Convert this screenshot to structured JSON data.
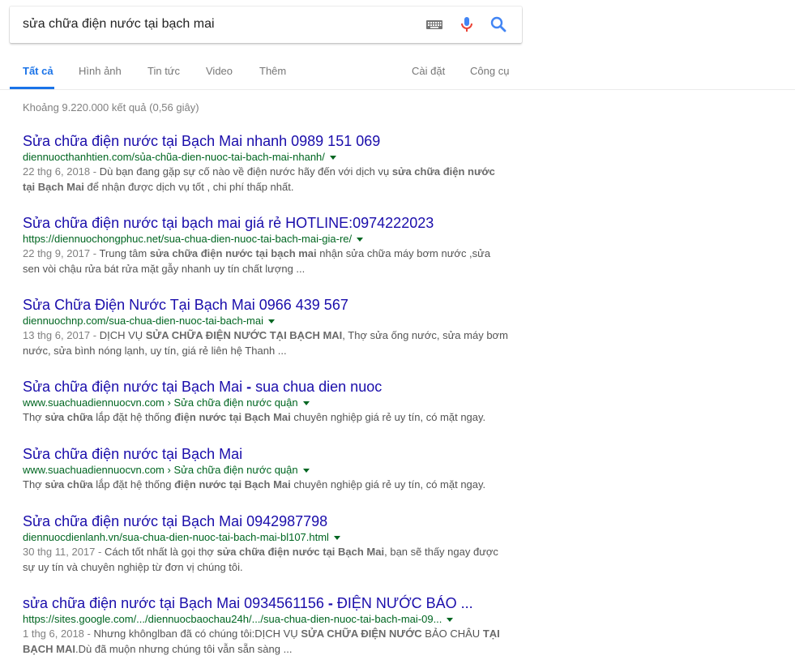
{
  "search": {
    "query": "sửa chữa điện nước tại bạch mai",
    "keyboard_icon": "keyboard-icon",
    "mic_icon": "microphone-icon",
    "search_icon": "search-icon",
    "colors": {
      "mic_blue": "#4285f4",
      "mic_red": "#ea4335",
      "search_blue": "#4285f4"
    }
  },
  "tabs": {
    "all": "Tất cả",
    "images": "Hình ảnh",
    "news": "Tin tức",
    "video": "Video",
    "more": "Thêm",
    "settings": "Cài đặt",
    "tools": "Công cụ",
    "active_color": "#1a73e8"
  },
  "stats": "Khoảng 9.220.000 kết quả (0,56 giây)",
  "results": [
    {
      "title": "Sửa chữa điện nước tại Bạch Mai nhanh 0989 151 069",
      "url": "diennuocthanhtien.com/sủa-chũa-dien-nuoc-tai-bach-mai-nhanh/",
      "date": "22 thg 6, 2018 - ",
      "snippet_parts": [
        {
          "t": "Dù bạn đang gặp sự cố nào về điện nước hãy đến với dịch vụ ",
          "b": false
        },
        {
          "t": "sửa chữa điện nước tại Bạch Mai",
          "b": true
        },
        {
          "t": " để nhận được dịch vụ tốt , chi phí thấp nhất.",
          "b": false
        }
      ]
    },
    {
      "title": "Sửa chữa điện nước tại bạch mai giá rẻ HOTLINE:0974222023",
      "url": "https://diennuochongphuc.net/sua-chua-dien-nuoc-tai-bach-mai-gia-re/",
      "date": "22 thg 9, 2017 - ",
      "snippet_parts": [
        {
          "t": "Trung tâm ",
          "b": false
        },
        {
          "t": "sửa chữa điện nước tại bạch mai",
          "b": true
        },
        {
          "t": " nhận sửa chữa máy bơm nước ,sửa sen vòi chậu rửa bát rửa mặt gẫy nhanh uy tín chất lượng ...",
          "b": false
        }
      ]
    },
    {
      "title": "Sửa Chữa Điện Nước Tại Bạch Mai 0966 439 567",
      "url": "diennuochnp.com/sua-chua-dien-nuoc-tai-bach-mai",
      "date": "13 thg 6, 2017 - ",
      "snippet_parts": [
        {
          "t": "DỊCH VỤ ",
          "b": false
        },
        {
          "t": "SỬA CHỮA ĐIỆN NƯỚC TẠI BẠCH MAI",
          "b": true
        },
        {
          "t": ", Thợ sửa ống nước, sửa máy bơm nước, sửa bình nóng lạnh, uy tín, giá rẻ liên hệ Thanh ...",
          "b": false
        }
      ]
    },
    {
      "title_parts": [
        {
          "t": "Sửa chữa điện nước tại Bạch Mai",
          "b": false
        },
        {
          "t": " - ",
          "b": true
        },
        {
          "t": "sua chua dien nuoc",
          "b": false
        }
      ],
      "url": "www.suachuadiennuocvn.com",
      "crumb": " › Sửa chữa điện nước quận",
      "date": "",
      "snippet_parts": [
        {
          "t": "Thợ ",
          "b": false
        },
        {
          "t": "sửa chữa",
          "b": true
        },
        {
          "t": " lắp đặt hệ thống ",
          "b": false
        },
        {
          "t": "điện nước tại Bạch Mai",
          "b": true
        },
        {
          "t": " chuyên nghiệp giá rẻ uy tín, có mặt ngay.",
          "b": false
        }
      ]
    },
    {
      "title": "Sửa chữa điện nước tại Bạch Mai",
      "url": "www.suachuadiennuocvn.com",
      "crumb": " › Sửa chữa điện nước quận",
      "date": "",
      "snippet_parts": [
        {
          "t": "Thợ ",
          "b": false
        },
        {
          "t": "sửa chữa",
          "b": true
        },
        {
          "t": " lắp đặt hệ thống ",
          "b": false
        },
        {
          "t": "điện nước tại Bạch Mai",
          "b": true
        },
        {
          "t": " chuyên nghiệp giá rẻ uy tín, có mặt ngay.",
          "b": false
        }
      ]
    },
    {
      "title": "Sửa chữa điện nước tại Bạch Mai 0942987798",
      "url": "diennuocdienlanh.vn/sua-chua-dien-nuoc-tai-bach-mai-bl107.html",
      "date": "30 thg 11, 2017 - ",
      "snippet_parts": [
        {
          "t": "Cách tốt nhất là gọi thợ ",
          "b": false
        },
        {
          "t": "sửa chữa điện nước tại Bạch Mai",
          "b": true
        },
        {
          "t": ", bạn sẽ thấy ngay được sự uy tín và chuyên nghiệp từ đơn vị chúng tôi.",
          "b": false
        }
      ]
    },
    {
      "title_parts": [
        {
          "t": "sửa chữa điện nước tại Bạch Mai 0934561156",
          "b": false
        },
        {
          "t": " - ",
          "b": true
        },
        {
          "t": "ĐIỆN NƯỚC BÁO ...",
          "b": false
        }
      ],
      "url": "https://sites.google.com/.../diennuocbaochau24h/.../sua-chua-dien-nuoc-tai-bach-mai-09...",
      "date": "1 thg 6, 2018 - ",
      "snippet_parts": [
        {
          "t": "Nhưng khônglban đã có chúng tôi:DỊCH VỤ ",
          "b": false
        },
        {
          "t": "SỬA CHỮA ĐIỆN NƯỚC",
          "b": true
        },
        {
          "t": " BẢO CHÂU ",
          "b": false
        },
        {
          "t": "TẠI BẠCH MAI",
          "b": true
        },
        {
          "t": ".Dù đã muộn nhưng chúng tôi vẫn sẵn sàng ...",
          "b": false
        }
      ]
    }
  ]
}
